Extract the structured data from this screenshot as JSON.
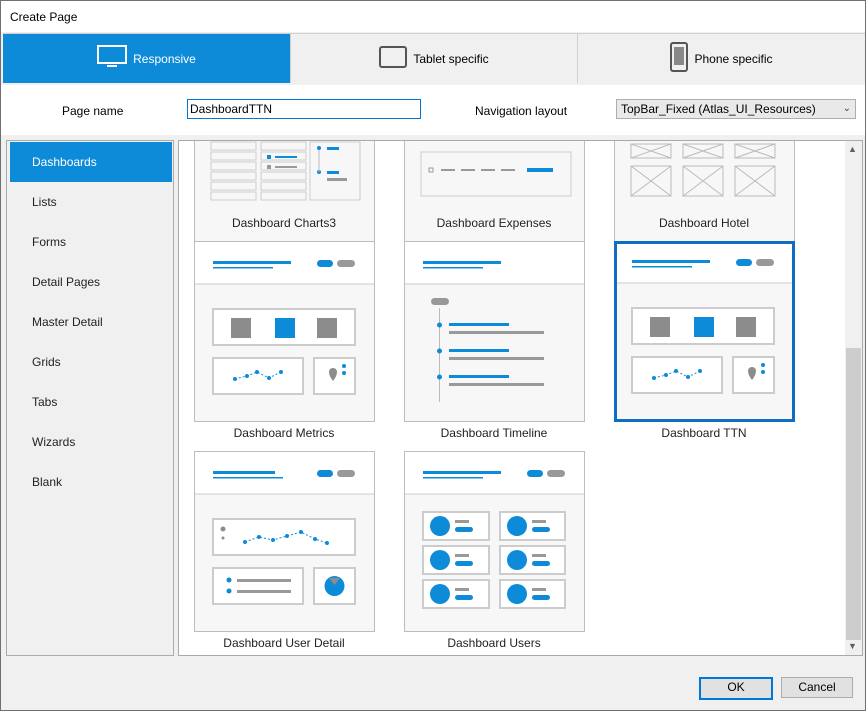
{
  "window": {
    "title": "Create Page"
  },
  "tabs": [
    {
      "label": "Responsive",
      "icon": "monitor-icon"
    },
    {
      "label": "Tablet specific",
      "icon": "tablet-icon"
    },
    {
      "label": "Phone specific",
      "icon": "phone-icon"
    }
  ],
  "form": {
    "page_name_label": "Page name",
    "page_name_value": "DashboardTTN",
    "nav_layout_label": "Navigation layout",
    "nav_layout_value": "TopBar_Fixed (Atlas_UI_Resources)"
  },
  "categories": [
    "Dashboards",
    "Lists",
    "Forms",
    "Detail Pages",
    "Master Detail",
    "Grids",
    "Tabs",
    "Wizards",
    "Blank"
  ],
  "selected_category": "Dashboards",
  "templates": [
    {
      "name": "Dashboard Charts3"
    },
    {
      "name": "Dashboard Expenses"
    },
    {
      "name": "Dashboard Hotel"
    },
    {
      "name": "Dashboard Metrics"
    },
    {
      "name": "Dashboard Timeline"
    },
    {
      "name": "Dashboard TTN"
    },
    {
      "name": "Dashboard User Detail"
    },
    {
      "name": "Dashboard Users"
    }
  ],
  "selected_template": "Dashboard TTN",
  "buttons": {
    "ok": "OK",
    "cancel": "Cancel"
  },
  "colors": {
    "accent": "#0e8bd8",
    "selected_border": "#0e6fc2",
    "placeholder_gray": "#8c8c8c"
  }
}
